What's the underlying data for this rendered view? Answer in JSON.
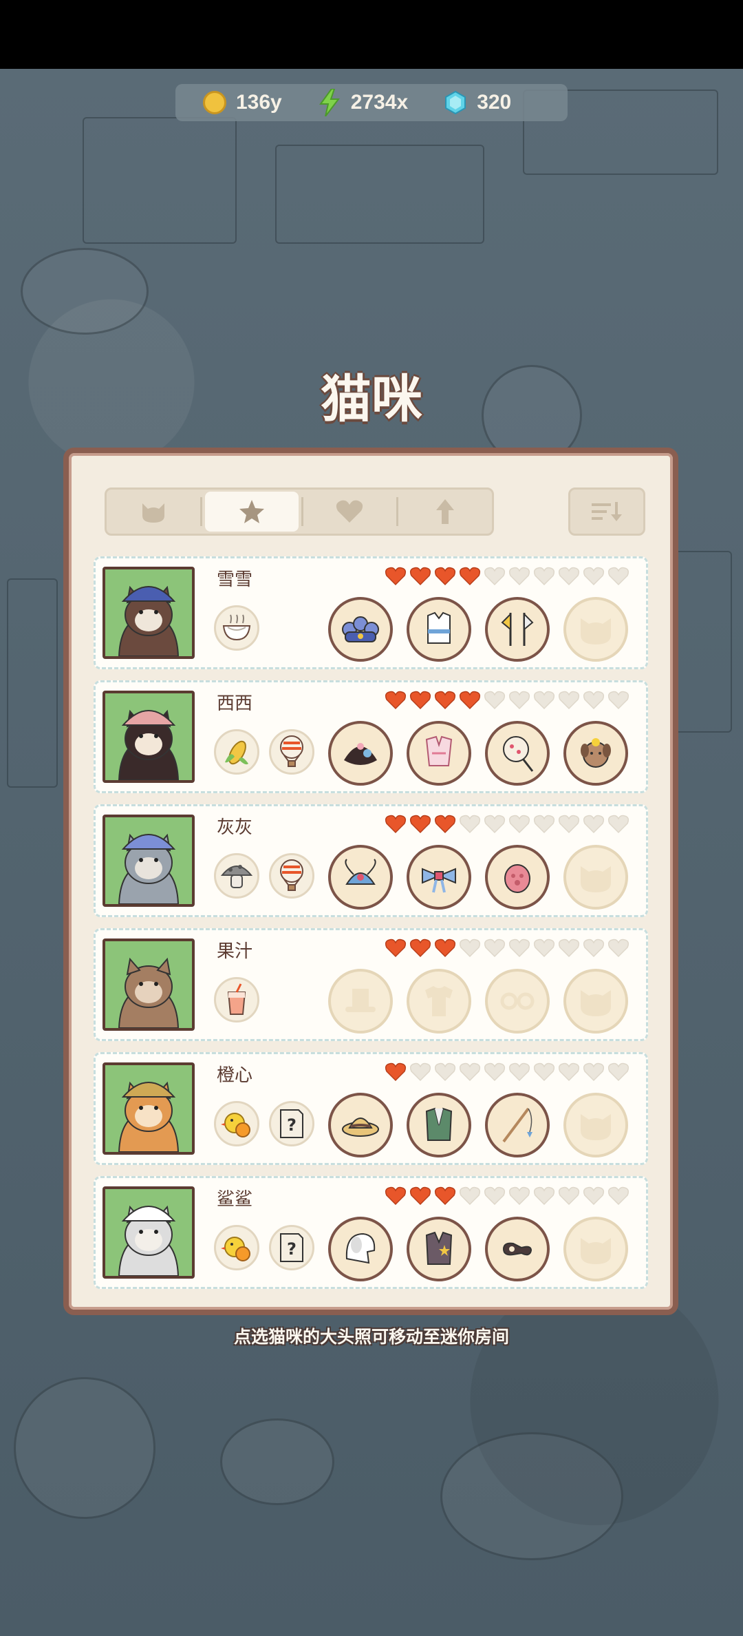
{
  "resources": {
    "coins": "136y",
    "energy": "2734x",
    "gems": "320"
  },
  "title": "猫咪",
  "tabs": [
    {
      "icon": "cat-head-icon",
      "active": false
    },
    {
      "icon": "star-icon",
      "active": true
    },
    {
      "icon": "heart-icon",
      "active": false
    },
    {
      "icon": "arrow-up-icon",
      "active": false
    }
  ],
  "sort_icon": "sort-descending-icon",
  "cats": [
    {
      "name": "雪雪",
      "hearts": 4,
      "max_hearts": 10,
      "foods": [
        "noodle-bowl-icon"
      ],
      "items": [
        "blue-crown-icon",
        "white-vest-icon",
        "flags-icon",
        "empty-slot-icon"
      ]
    },
    {
      "name": "西西",
      "hearts": 4,
      "max_hearts": 10,
      "foods": [
        "corn-icon",
        "hot-air-balloon-icon"
      ],
      "items": [
        "flower-hair-icon",
        "pink-top-icon",
        "hand-fan-icon",
        "plush-dog-icon"
      ]
    },
    {
      "name": "灰灰",
      "hearts": 3,
      "max_hearts": 10,
      "foods": [
        "mushroom-icon",
        "hot-air-balloon-icon"
      ],
      "items": [
        "opera-headdress-icon",
        "blue-bow-icon",
        "pink-paw-icon",
        "empty-slot-icon"
      ]
    },
    {
      "name": "果汁",
      "hearts": 3,
      "max_hearts": 10,
      "foods": [
        "juice-drink-icon"
      ],
      "items": [
        "hat-slot-icon",
        "shirt-slot-icon",
        "glasses-slot-icon",
        "empty-slot-icon"
      ]
    },
    {
      "name": "橙心",
      "hearts": 1,
      "max_hearts": 10,
      "foods": [
        "orange-chick-icon",
        "mystery-note-icon"
      ],
      "items": [
        "straw-hat-icon",
        "green-vest-icon",
        "fishing-rod-icon",
        "empty-slot-icon"
      ]
    },
    {
      "name": "鲨鲨",
      "hearts": 3,
      "max_hearts": 10,
      "foods": [
        "orange-chick-icon",
        "mystery-note-icon"
      ],
      "items": [
        "white-hood-icon",
        "sheriff-vest-icon",
        "eye-mask-icon",
        "empty-slot-icon"
      ]
    }
  ],
  "hint": "点选猫咪的大头照可移动至迷你房间",
  "colors": {
    "panel_bg": "#f3ece0",
    "panel_border": "#8a5e50",
    "heart_full": "#e8562a",
    "heart_empty": "#ebe6dc",
    "portrait_bg": "#8cc479"
  }
}
